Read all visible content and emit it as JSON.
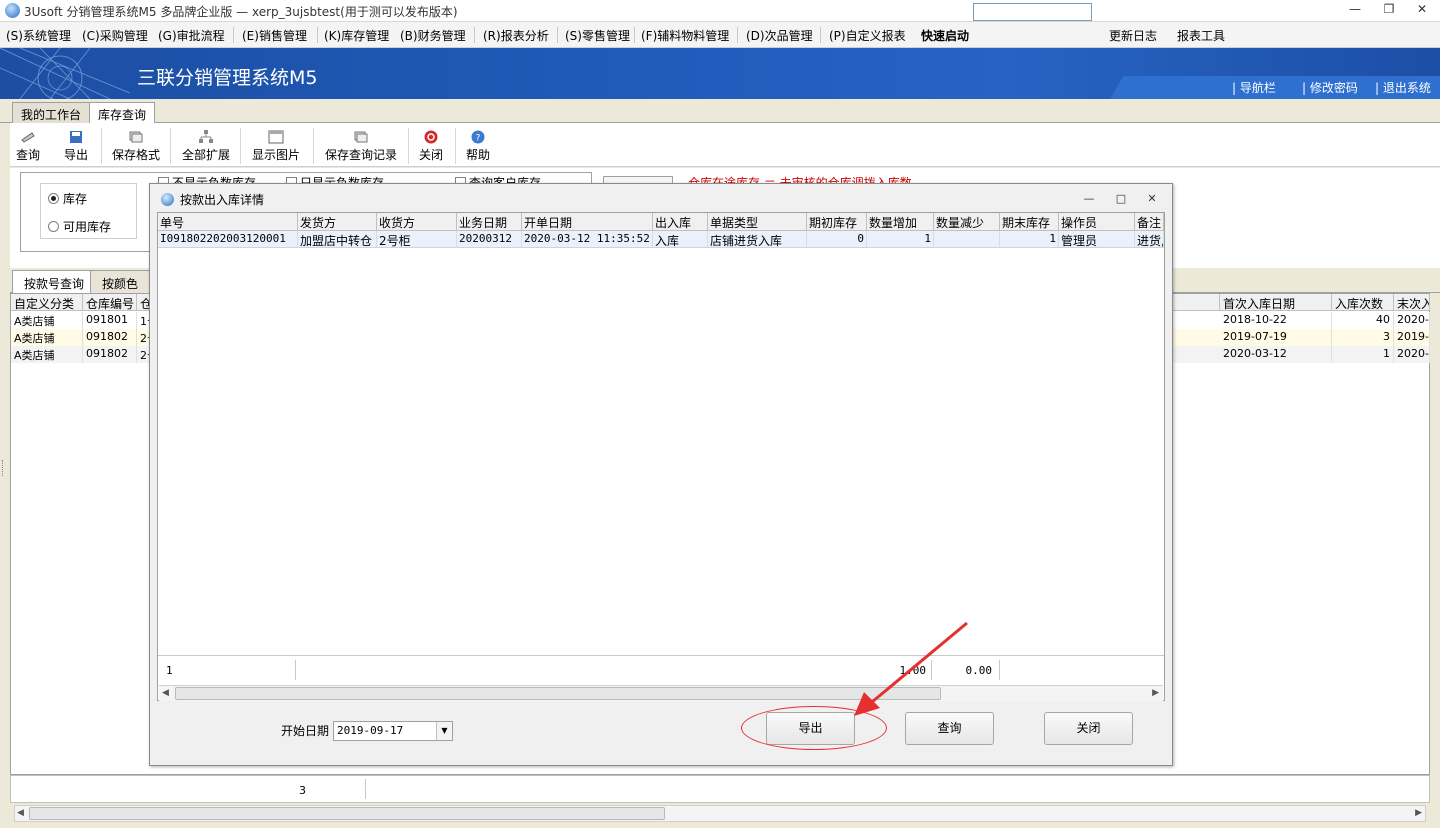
{
  "window": {
    "title": "3Usoft 分销管理系统M5 多品牌企业版 — xerp_3ujsbtest(用于测可以发布版本)"
  },
  "menu": {
    "items": [
      "(S)系统管理",
      "(C)采购管理",
      "(G)审批流程",
      "(E)销售管理",
      "(K)库存管理",
      "(B)财务管理",
      "(R)报表分析",
      "(S)零售管理",
      "(F)辅料物料管理",
      "(D)次品管理",
      "(P)自定义报表"
    ],
    "quick_label": "快速启动",
    "update_log": "更新日志",
    "report_tool": "报表工具"
  },
  "banner": {
    "title": "三联分销管理系统M5",
    "links": [
      "导航栏",
      "修改密码",
      "退出系统"
    ]
  },
  "tabs": [
    "我的工作台",
    "库存查询"
  ],
  "toolbar": [
    "查询",
    "导出",
    "保存格式",
    "全部扩展",
    "显示图片",
    "保存查询记录",
    "关闭",
    "帮助"
  ],
  "filter": {
    "radio1": "库存",
    "radio2": "可用库存",
    "check1": "不显示负数库存",
    "check2": "只显示负数库存",
    "check3": "查询客户库存",
    "hint": "仓库在途库存 ＝ 未审核的仓库调拨入库数"
  },
  "subtabs": [
    "按款号查询",
    "按颜色查"
  ],
  "main_grid": {
    "left_headers": [
      "自定义分类",
      "仓库编号",
      "仓"
    ],
    "right_headers": [
      "首次入库日期",
      "入库次数",
      "末次入"
    ],
    "rows": [
      {
        "cat": "A类店铺",
        "wh": "091801",
        "w2": "1号",
        "first": "2018-10-22",
        "times": "40",
        "last": "2020-"
      },
      {
        "cat": "A类店铺",
        "wh": "091802",
        "w2": "2号",
        "first": "2019-07-19",
        "times": "3",
        "last": "2019-"
      },
      {
        "cat": "A类店铺",
        "wh": "091802",
        "w2": "2号",
        "first": "2020-03-12",
        "times": "1",
        "last": "2020-"
      }
    ],
    "footer_count": "3"
  },
  "dialog": {
    "title": "按款出入库详情",
    "headers": [
      "单号",
      "发货方",
      "收货方",
      "业务日期",
      "开单日期",
      "出入库",
      "单据类型",
      "期初库存",
      "数量增加",
      "数量减少",
      "期末库存",
      "操作员",
      "备注"
    ],
    "row": [
      "I091802202003120001",
      "加盟店中转仓",
      "2号柜",
      "20200312",
      "2020-03-12 11:35:52",
      "入库",
      "店铺进货入库",
      "0",
      "1",
      "",
      "1",
      "管理员",
      "进货,"
    ],
    "footer": {
      "count": "1",
      "sum_inc": "1.00",
      "sum_dec": "0.00"
    },
    "start_date_label": "开始日期",
    "start_date": "2019-09-17",
    "btn_export": "导出",
    "btn_query": "查询",
    "btn_close": "关闭"
  },
  "colors": {
    "banner": "#1e5ab8",
    "highlight": "#e53030"
  }
}
